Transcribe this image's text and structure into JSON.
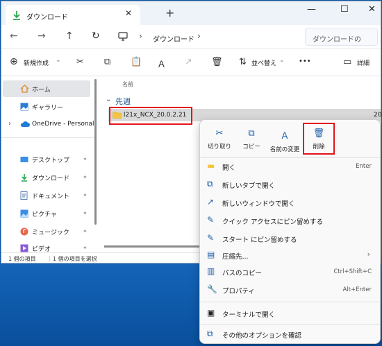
{
  "tab": {
    "title": "ダウンロード",
    "close": "✕"
  },
  "new_tab": "+",
  "window_controls": {
    "minimize": "—",
    "maximize": "☐",
    "close": "✕"
  },
  "nav": {
    "back": "←",
    "forward": "→",
    "up": "↑",
    "refresh": "↻"
  },
  "address": {
    "crumb": "ダウンロード",
    "sep1": "›",
    "sep2": "›"
  },
  "search": {
    "placeholder": "ダウンロードの"
  },
  "commands": {
    "new": "新規作成",
    "new_arrow": "⌄",
    "sort": "並べ替え",
    "sort_arrow": "⌄",
    "more": "•••",
    "details": "詳細"
  },
  "sidebar": {
    "home": "ホーム",
    "gallery": "ギャラリー",
    "onedrive": "OneDrive - Personal",
    "expander": "›",
    "pinned": [
      {
        "label": "デスクトップ"
      },
      {
        "label": "ダウンロード"
      },
      {
        "label": "ドキュメント"
      },
      {
        "label": "ピクチャ"
      },
      {
        "label": "ミュージック"
      },
      {
        "label": "ビデオ"
      }
    ],
    "pin_glyph": "📌"
  },
  "main": {
    "column_name": "名前",
    "group_label": "先週",
    "group_chevron": "⌄",
    "file_name": "l21x_NCX_20.0.2.21",
    "file_date": "20"
  },
  "status": {
    "count": "1 個の項目",
    "selected": "1 個の項目を選択"
  },
  "context_menu": {
    "quick_actions": [
      {
        "label": "切り取り",
        "icon": "✂"
      },
      {
        "label": "コピー",
        "icon": "⧉"
      },
      {
        "label": "名前の変更",
        "icon": "Ａ"
      },
      {
        "label": "削除",
        "icon": "🗑"
      }
    ],
    "items": [
      {
        "label": "開く",
        "shortcut": "Enter"
      },
      {
        "label": "新しいタブで開く",
        "shortcut": ""
      },
      {
        "label": "新しいウィンドウで開く",
        "shortcut": ""
      },
      {
        "label": "クイック アクセスにピン留めする",
        "shortcut": ""
      },
      {
        "label": "スタート にピン留めする",
        "shortcut": ""
      },
      {
        "label": "圧縮先...",
        "shortcut": "",
        "arrow": "›"
      },
      {
        "label": "パスのコピー",
        "shortcut": "Ctrl+Shift+C"
      },
      {
        "label": "プロパティ",
        "shortcut": "Alt+Enter"
      },
      {
        "label": "ターミナルで開く",
        "shortcut": ""
      },
      {
        "label": "その他のオプションを確認",
        "shortcut": ""
      }
    ]
  },
  "colors": {
    "accent": "#1f5fa8",
    "highlight": "#e3141b",
    "folder": "#f5c542"
  }
}
